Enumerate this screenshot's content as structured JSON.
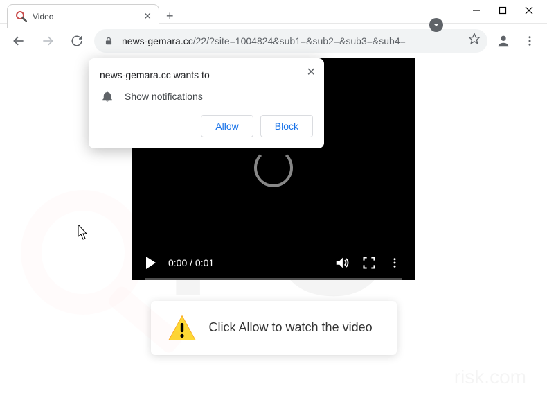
{
  "window": {
    "tab_title": "Video",
    "minimize": "–",
    "maximize": "□",
    "close": "✕"
  },
  "toolbar": {
    "url_host": "news-gemara.cc",
    "url_path": "/22/?site=1004824&sub1=&sub2=&sub3=&sub4="
  },
  "permission": {
    "title": "news-gemara.cc wants to",
    "label": "Show notifications",
    "allow": "Allow",
    "block": "Block"
  },
  "video": {
    "time": "0:00 / 0:01"
  },
  "prompt": {
    "text": "Click Allow to watch the video"
  },
  "watermark": {
    "big": "PC",
    "small": "risk.com"
  }
}
